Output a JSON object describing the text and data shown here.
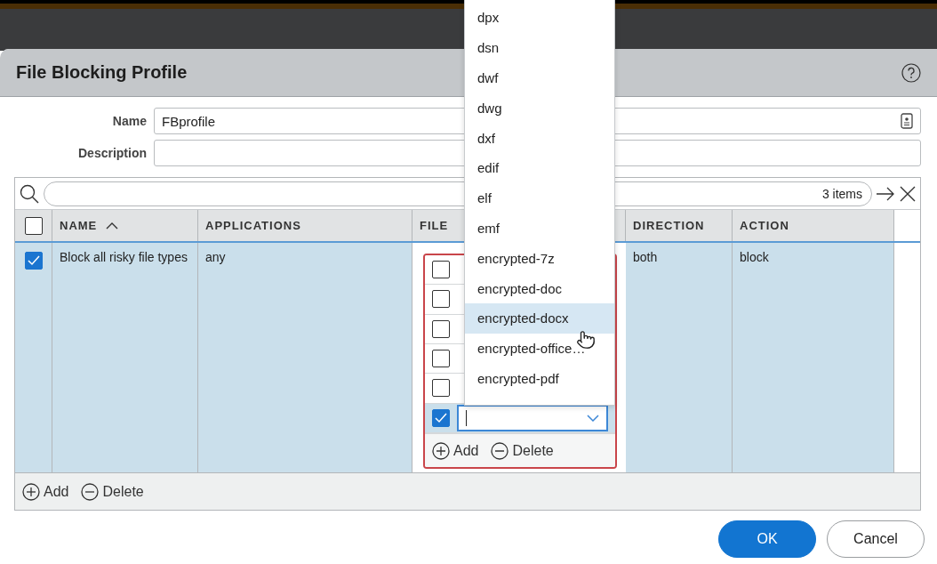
{
  "dialog": {
    "title": "File Blocking Profile"
  },
  "form": {
    "fields": [
      {
        "label": "Name",
        "value": "FBprofile",
        "kind": "name"
      },
      {
        "label": "Description",
        "kind": "text"
      }
    ]
  },
  "search": {
    "count": "3 items"
  },
  "table": {
    "select_all": {
      "checked": false
    },
    "columns": [
      {
        "label": "NAME",
        "sorted": true
      },
      {
        "label": "APPLICATIONS",
        "sorted": false
      },
      {
        "label": "FILE",
        "sorted": false
      },
      {
        "label": "DIRECTION",
        "sorted": false
      },
      {
        "label": "ACTION",
        "sorted": false
      }
    ],
    "rows": [
      {
        "checked": true,
        "selected": true,
        "name": "Block all risky file types",
        "applications": "any",
        "direction": "both",
        "action": "block",
        "file_editor": {
          "rows": [
            {
              "checked": false,
              "kind": "plain"
            },
            {
              "checked": false,
              "kind": "plain"
            },
            {
              "checked": false,
              "kind": "plain"
            },
            {
              "checked": false,
              "kind": "plain"
            },
            {
              "checked": false,
              "kind": "plain"
            },
            {
              "checked": true,
              "kind": "input"
            }
          ],
          "buttons": [
            {
              "label": "Add",
              "kind": "add"
            },
            {
              "label": "Delete",
              "kind": "delete"
            }
          ]
        }
      }
    ],
    "buttons": [
      {
        "label": "Add",
        "kind": "add"
      },
      {
        "label": "Delete",
        "kind": "delete"
      }
    ]
  },
  "dropdown": {
    "options": [
      {
        "label": "dpx",
        "highlighted": false
      },
      {
        "label": "dsn",
        "highlighted": false
      },
      {
        "label": "dwf",
        "highlighted": false
      },
      {
        "label": "dwg",
        "highlighted": false
      },
      {
        "label": "dxf",
        "highlighted": false
      },
      {
        "label": "edif",
        "highlighted": false
      },
      {
        "label": "elf",
        "highlighted": false
      },
      {
        "label": "emf",
        "highlighted": false
      },
      {
        "label": "encrypted-7z",
        "highlighted": false
      },
      {
        "label": "encrypted-doc",
        "highlighted": false
      },
      {
        "label": "encrypted-docx",
        "highlighted": true
      },
      {
        "label": "encrypted-office…",
        "highlighted": false
      },
      {
        "label": "encrypted-pdf",
        "highlighted": false
      }
    ]
  },
  "footer": {
    "buttons": [
      {
        "label": "OK",
        "kind": "primary"
      },
      {
        "label": "Cancel",
        "kind": "secondary"
      }
    ]
  }
}
